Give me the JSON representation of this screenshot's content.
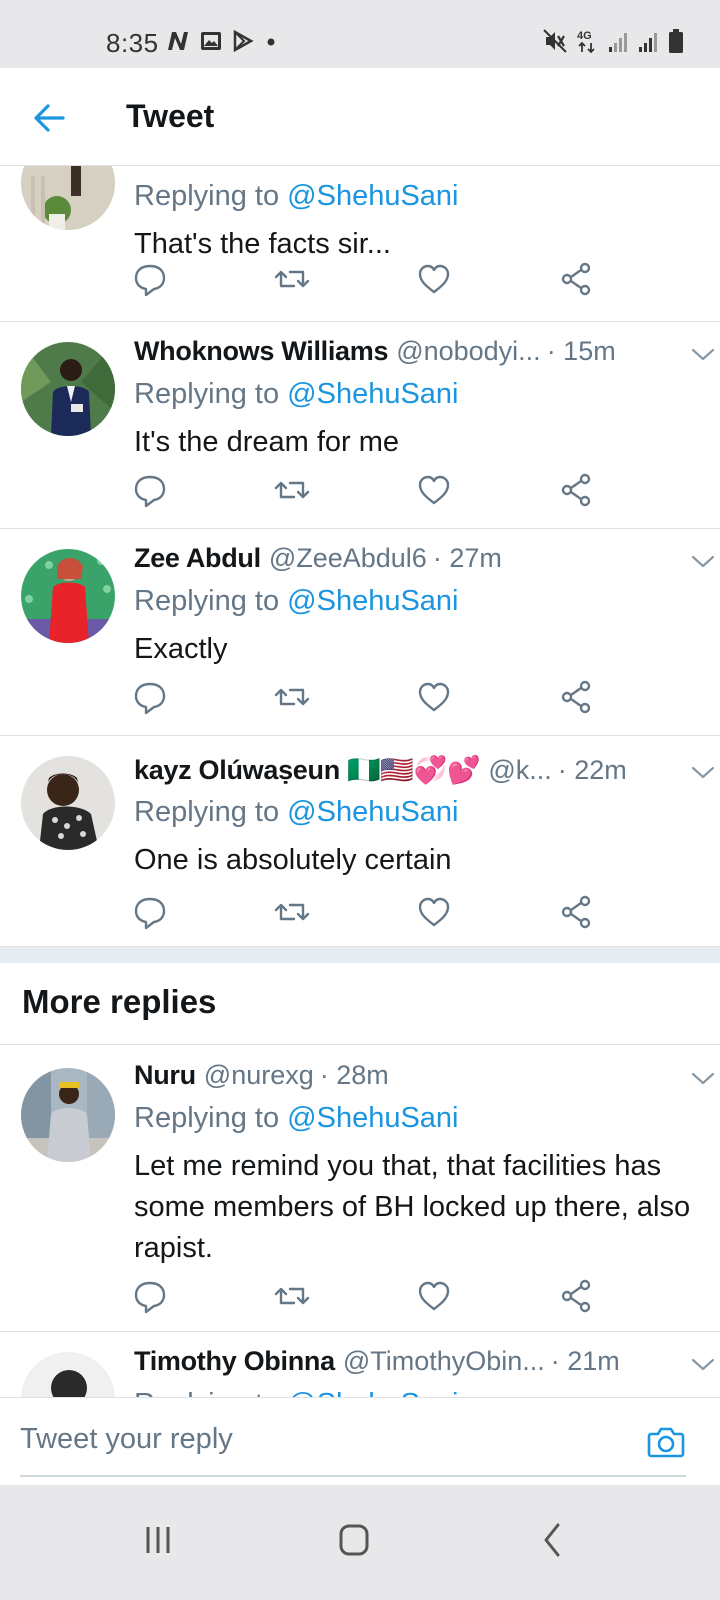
{
  "status_bar": {
    "time": "8:35",
    "network": "4G",
    "left_icons": [
      "n-icon",
      "gallery-icon",
      "play-store-icon",
      "dot-icon"
    ],
    "right_icons": [
      "mute-icon",
      "network-4g-icon",
      "signal-icon",
      "signal-icon",
      "battery-icon"
    ]
  },
  "header": {
    "title": "Tweet"
  },
  "colors": {
    "accent": "#1b95e0",
    "secondary_text": "#657786",
    "divider": "#dfe3e6"
  },
  "tweets": [
    {
      "name": "",
      "handle": "",
      "time": "",
      "replying_prefix": "Replying to ",
      "replying_to": "@ShehuSani",
      "text": "That's the facts sir..."
    },
    {
      "name": "Whoknows Williams",
      "handle": "@nobodyi...",
      "time": "· 15m",
      "replying_prefix": "Replying to ",
      "replying_to": "@ShehuSani",
      "text": "It's the dream for me"
    },
    {
      "name": "Zee Abdul",
      "handle": "@ZeeAbdul6",
      "time": "· 27m",
      "replying_prefix": "Replying to ",
      "replying_to": "@ShehuSani",
      "text": "Exactly"
    },
    {
      "name": "kayz Olúwaṣeun 🇳🇬🇺🇸💞💕",
      "handle": "@k...",
      "time": "· 22m",
      "replying_prefix": "Replying to ",
      "replying_to": "@ShehuSani",
      "text": "One is absolutely certain"
    },
    {
      "name": "Nuru",
      "handle": "@nurexg",
      "time": "· 28m",
      "replying_prefix": "Replying to ",
      "replying_to": "@ShehuSani",
      "text": "Let me remind you that, that facilities has some members of BH locked up there, also rapist."
    },
    {
      "name": "Timothy Obinna",
      "handle": "@TimothyObin...",
      "time": "· 21m",
      "replying_prefix": "Replying to ",
      "replying_to": "@ShehuSani",
      "text": ""
    }
  ],
  "more_replies": {
    "title": "More replies"
  },
  "reply_bar": {
    "placeholder": "Tweet your reply"
  },
  "nav_bar": {
    "buttons": [
      "recents-icon",
      "home-icon",
      "back-icon"
    ]
  }
}
